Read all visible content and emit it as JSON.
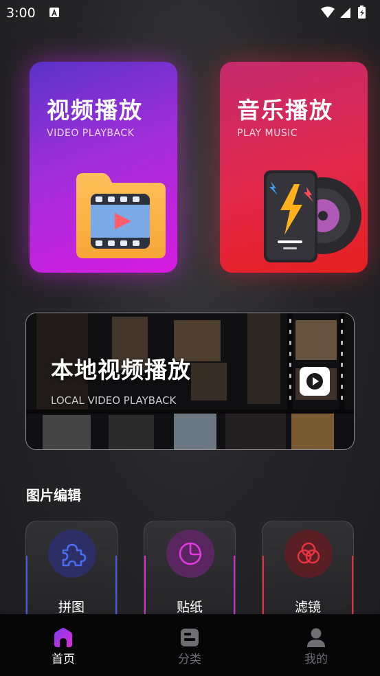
{
  "status": {
    "time": "3:00"
  },
  "tiles": {
    "video": {
      "title": "视频播放",
      "subtitle": "VIDEO PLAYBACK",
      "icon": "video-folder-icon"
    },
    "music": {
      "title": "音乐播放",
      "subtitle": "PLAY MUSIC",
      "icon": "music-device-icon"
    }
  },
  "banner": {
    "title": "本地视频播放",
    "subtitle": "LOCAL VIDEO PLAYBACK",
    "icon": "play-button-icon"
  },
  "edit_section": {
    "title": "图片编辑",
    "items": [
      {
        "label": "拼图",
        "icon": "puzzle-icon",
        "accent": "#3f5fe0",
        "icon_bg": "#2b2f66",
        "icon_color": "#4a6cf0"
      },
      {
        "label": "贴纸",
        "icon": "sticker-icon",
        "accent": "#d22fd0",
        "icon_bg": "#5a2660",
        "icon_color": "#e03ae0"
      },
      {
        "label": "滤镜",
        "icon": "filter-icon",
        "accent": "#e0303a",
        "icon_bg": "#5a1f24",
        "icon_color": "#ee3340"
      }
    ]
  },
  "nav": {
    "active_color": "#ffffff",
    "inactive_color": "#6f6f73",
    "items": [
      {
        "label": "首页",
        "icon": "home-icon",
        "active": true
      },
      {
        "label": "分类",
        "icon": "category-icon",
        "active": false
      },
      {
        "label": "我的",
        "icon": "profile-icon",
        "active": false
      }
    ]
  }
}
